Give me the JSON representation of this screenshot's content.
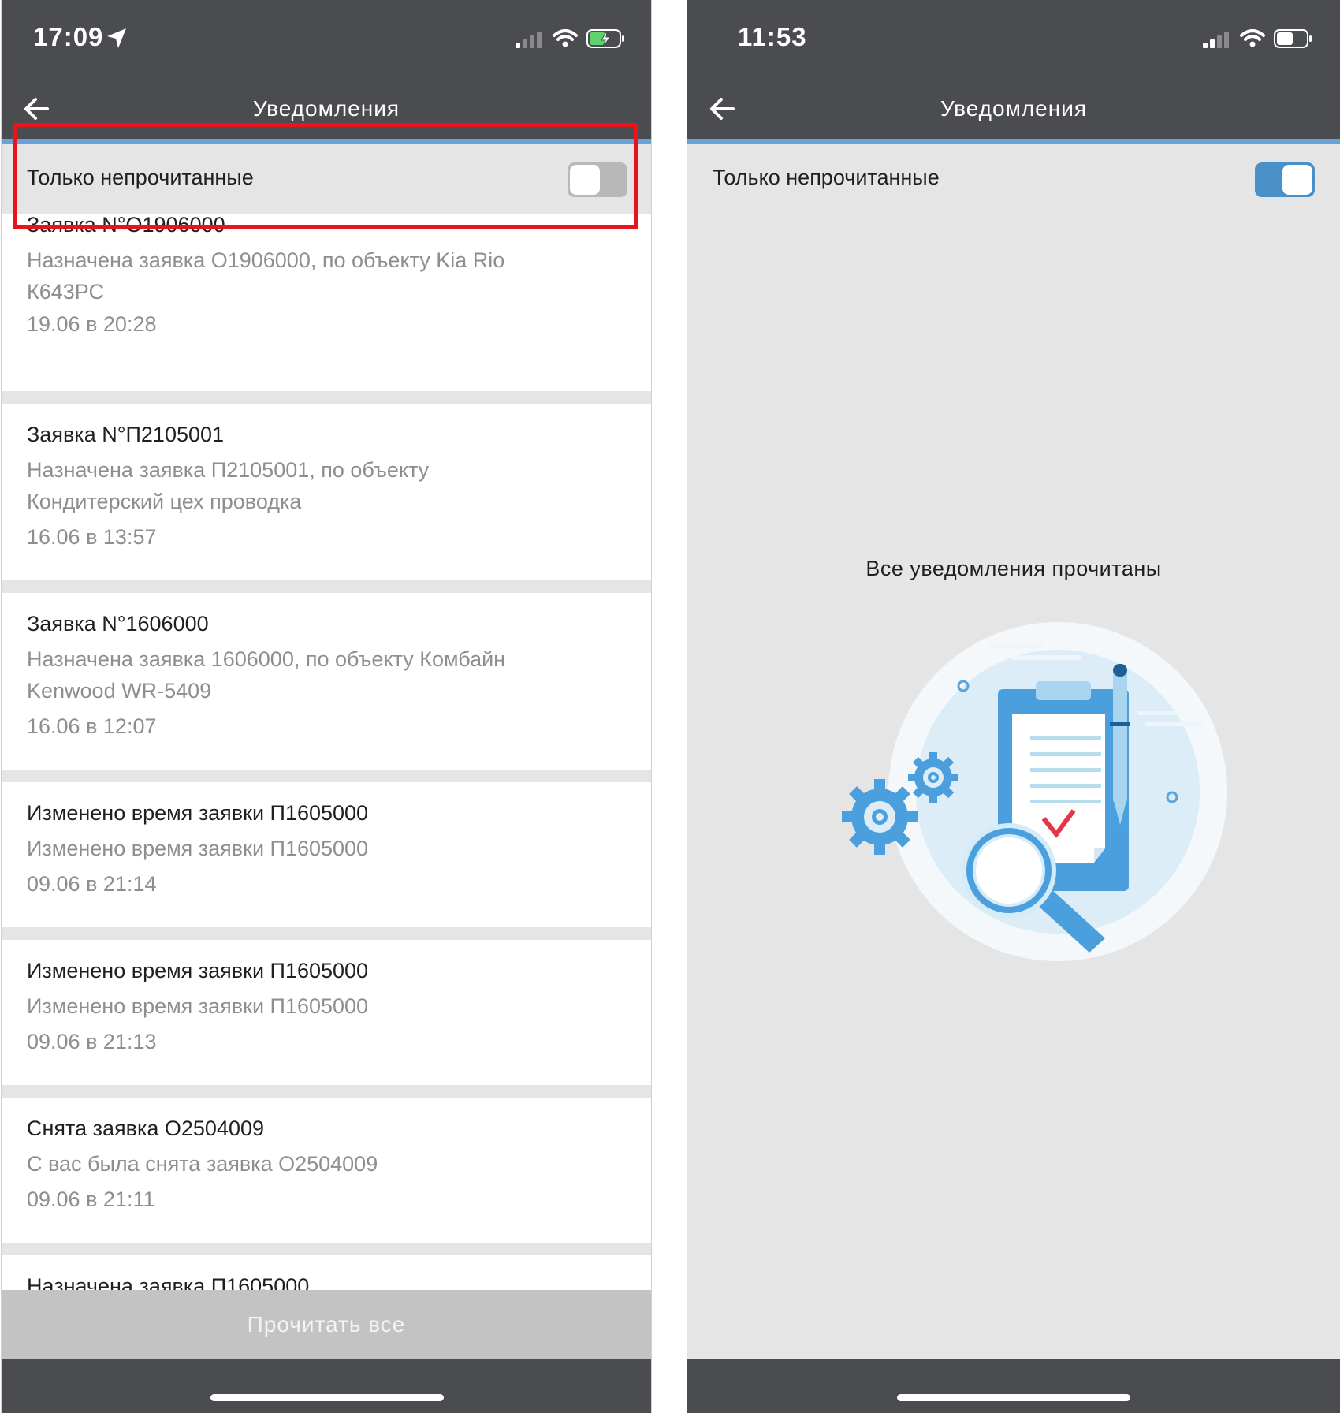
{
  "left_screen": {
    "status_time": "17:09",
    "nav_title": "Уведомления",
    "filter_label": "Только непрочитанные",
    "filter_on": false,
    "notifications": [
      {
        "title": "Заявка N°О1906000",
        "body_lines": [
          "Назначена заявка  О1906000, по объекту Kia Rio",
          "К643РС"
        ],
        "date": "19.06 в 20:28"
      },
      {
        "title": "Заявка N°П2105001",
        "body_lines": [
          "Назначена заявка  П2105001, по объекту",
          "Кондитерский цех проводка"
        ],
        "date": "16.06 в 13:57"
      },
      {
        "title": "Заявка N°1606000",
        "body_lines": [
          "Назначена заявка  1606000, по объекту Комбайн",
          "Kenwood WR-5409"
        ],
        "date": "16.06 в 12:07"
      },
      {
        "title": "Изменено время заявки П1605000",
        "body_lines": [
          "Изменено время заявки П1605000"
        ],
        "date": "09.06 в 21:14"
      },
      {
        "title": "Изменено время заявки П1605000",
        "body_lines": [
          "Изменено время заявки П1605000"
        ],
        "date": "09.06 в 21:13"
      },
      {
        "title": "Снята заявка О2504009",
        "body_lines": [
          "С вас была снята заявка О2504009"
        ],
        "date": "09.06 в 21:11"
      },
      {
        "title": "Назначена заявка П1605000",
        "body_lines": [],
        "date": ""
      }
    ],
    "read_all_label": "Прочитать все"
  },
  "right_screen": {
    "status_time": "11:53",
    "nav_title": "Уведомления",
    "filter_label": "Только непрочитанные",
    "filter_on": true,
    "empty_message": "Все уведомления прочитаны"
  },
  "colors": {
    "top_bar": "#4b4c50",
    "accent_blue": "#4a90c8",
    "highlight_red": "#e8141c",
    "battery_charging": "#5fd36a"
  },
  "icons": [
    "location-arrow-icon",
    "signal-icon",
    "wifi-icon",
    "battery-icon",
    "back-arrow-icon",
    "empty-notifications-illustration"
  ]
}
